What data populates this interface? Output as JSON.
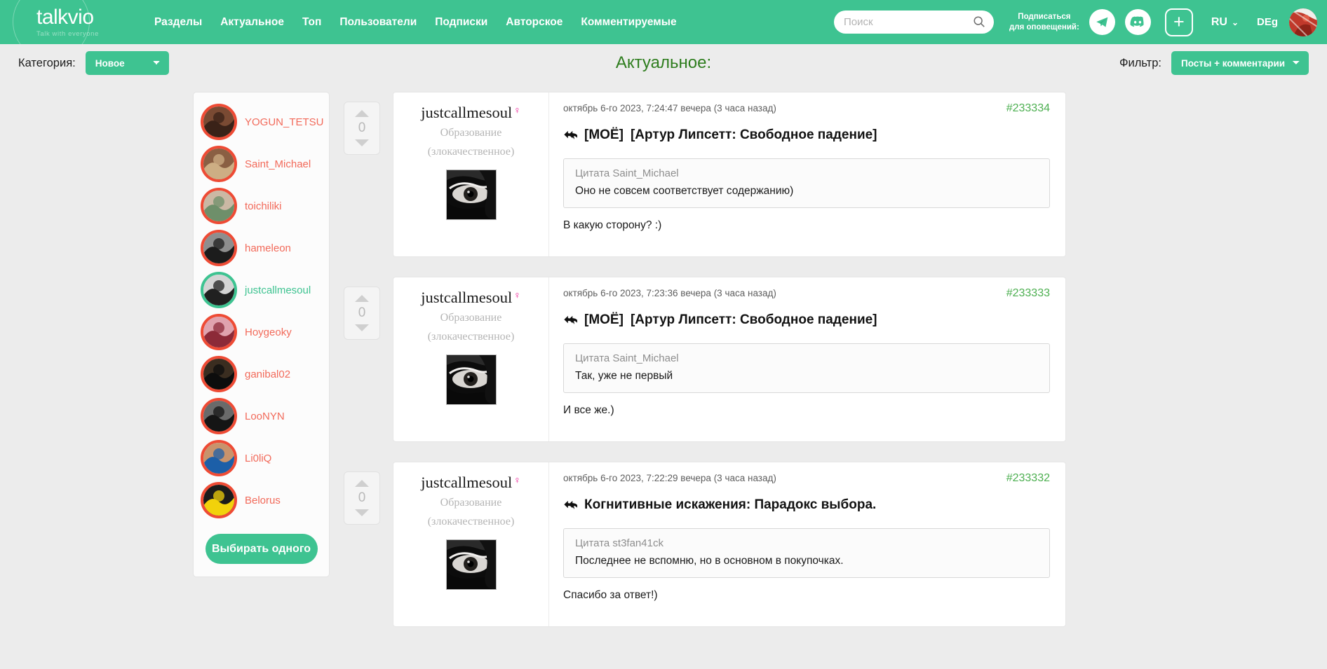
{
  "brand": {
    "name": "talkvio",
    "tagline": "Talk with everyone",
    "accent": "#3ec391"
  },
  "header": {
    "nav": [
      {
        "label": "Разделы"
      },
      {
        "label": "Актуальное"
      },
      {
        "label": "Топ"
      },
      {
        "label": "Пользователи"
      },
      {
        "label": "Подписки"
      },
      {
        "label": "Авторское"
      },
      {
        "label": "Комментируемые"
      }
    ],
    "search": {
      "placeholder": "Поиск",
      "value": ""
    },
    "subscribe_label_line1": "Подписаться",
    "subscribe_label_line2": "для оповещений:",
    "telegram_icon": "telegram-icon",
    "discord_icon": "discord-icon",
    "create_icon": "plus-icon",
    "language": "RU",
    "user_short": "DEg"
  },
  "toolbar": {
    "category_label": "Категория:",
    "category_value": "Новое",
    "category_options": [
      "Новое"
    ],
    "page_title": "Актуальное:",
    "filter_label": "Фильтр:",
    "filter_value": "Посты + комментарии",
    "filter_options": [
      "Посты + комментарии"
    ]
  },
  "sidebar": {
    "users": [
      {
        "name": "YOGUN_TETSU",
        "active": false,
        "c1": "#3a2218",
        "c2": "#7a4a33"
      },
      {
        "name": "Saint_Michael",
        "active": false,
        "c1": "#cdae84",
        "c2": "#8a5f43"
      },
      {
        "name": "toichiliki",
        "active": false,
        "c1": "#6e8f6a",
        "c2": "#cbb8a4"
      },
      {
        "name": "hameleon",
        "active": false,
        "c1": "#1c1c1c",
        "c2": "#8e8e8e"
      },
      {
        "name": "justcallmesoul",
        "active": true,
        "c1": "#202020",
        "c2": "#d4d4d4"
      },
      {
        "name": "Hoygeoky",
        "active": false,
        "c1": "#8c2a38",
        "c2": "#e0a3ae"
      },
      {
        "name": "ganibal02",
        "active": false,
        "c1": "#0d0d0d",
        "c2": "#3a2d20"
      },
      {
        "name": "LooNYN",
        "active": false,
        "c1": "#151515",
        "c2": "#6a6a6a"
      },
      {
        "name": "Li0liQ",
        "active": false,
        "c1": "#1c5fa8",
        "c2": "#c8936c"
      },
      {
        "name": "Belorus",
        "active": false,
        "c1": "#f2d20b",
        "c2": "#1b1b1b"
      }
    ],
    "pick_one_label": "Выбирать одного"
  },
  "posts": [
    {
      "vote_count": "0",
      "author": "justcallmesoul",
      "gender_symbol": "♀",
      "rank_line1": "Образование",
      "rank_line2": "(злокачественное)",
      "date": "октябрь 6-го 2023, 7:24:47 вечера (3 часа назад)",
      "id": "#233334",
      "reply_icon": "reply-arrow-icon",
      "mine_tag": "[МОЁ]",
      "title": "[Артур Липсетт: Свободное падение]",
      "quote_head": "Цитата Saint_Michael",
      "quote_body": "Оно не совсем соответствует содержанию)",
      "text": "В какую сторону? :)"
    },
    {
      "vote_count": "0",
      "author": "justcallmesoul",
      "gender_symbol": "♀",
      "rank_line1": "Образование",
      "rank_line2": "(злокачественное)",
      "date": "октябрь 6-го 2023, 7:23:36 вечера (3 часа назад)",
      "id": "#233333",
      "reply_icon": "reply-arrow-icon",
      "mine_tag": "[МОЁ]",
      "title": "[Артур Липсетт: Свободное падение]",
      "quote_head": "Цитата Saint_Michael",
      "quote_body": "Так, уже не первый",
      "text": "И все же.)"
    },
    {
      "vote_count": "0",
      "author": "justcallmesoul",
      "gender_symbol": "♀",
      "rank_line1": "Образование",
      "rank_line2": "(злокачественное)",
      "date": "октябрь 6-го 2023, 7:22:29 вечера (3 часа назад)",
      "id": "#233332",
      "reply_icon": "reply-arrow-icon",
      "mine_tag": "",
      "title": "Когнитивные искажения: Парадокс выбора.",
      "quote_head": "Цитата st3fan41ck",
      "quote_body": "Последнее не вспомню, но в основном в покупочках.",
      "text": "Спасибо за ответ!)"
    }
  ]
}
